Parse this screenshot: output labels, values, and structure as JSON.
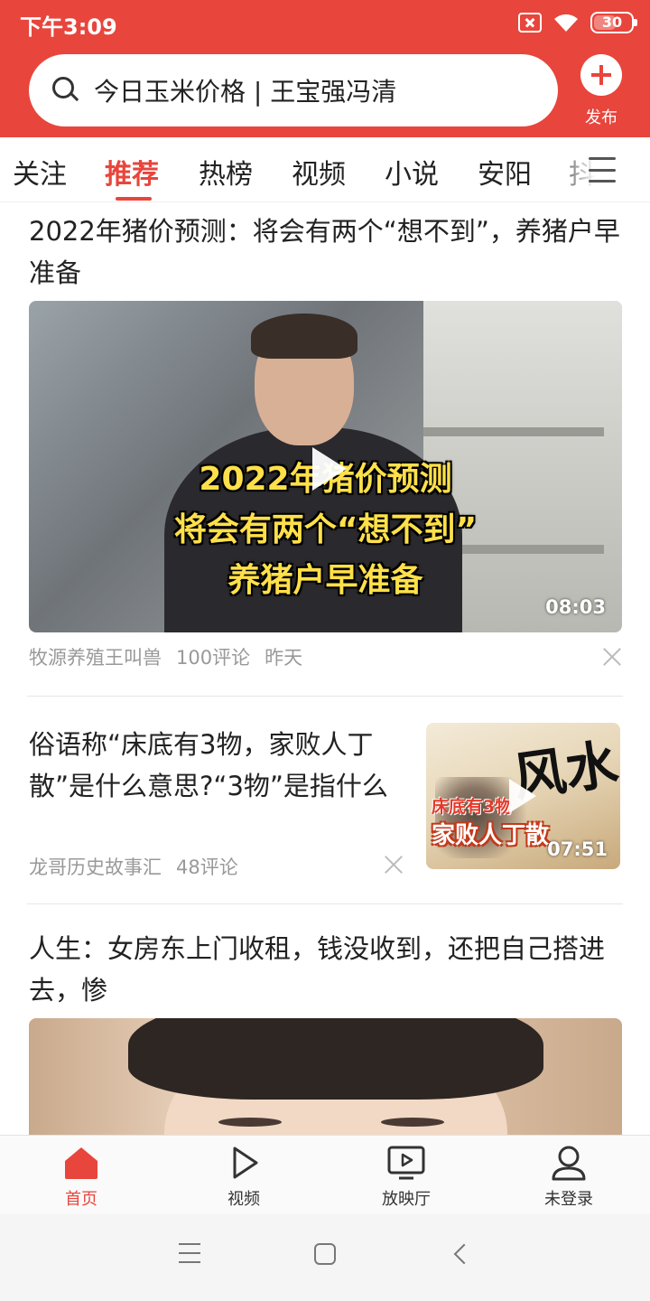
{
  "status_bar": {
    "time": "下午3:09",
    "battery": "30",
    "icons": [
      "sim-off-icon",
      "wifi-icon",
      "battery-icon"
    ]
  },
  "header": {
    "search_placeholder": "今日玉米价格 | 王宝强冯清",
    "publish_label": "发布",
    "accent_color": "#e8453c"
  },
  "tabs": {
    "items": [
      {
        "label": "关注"
      },
      {
        "label": "推荐",
        "active": true
      },
      {
        "label": "热榜"
      },
      {
        "label": "视频"
      },
      {
        "label": "小说"
      },
      {
        "label": "安阳"
      },
      {
        "label": "抖"
      }
    ]
  },
  "feed": {
    "articles": [
      {
        "title": "2022年猪价预测：将会有两个“想不到”，养猪户早准备",
        "video_overlay": [
          "2022年猪价预测",
          "将会有两个“想不到”",
          "养猪户早准备"
        ],
        "duration": "08:03",
        "source": "牧源养殖王叫兽",
        "comments": "100评论",
        "time": "昨天"
      },
      {
        "title": "俗语称“床底有3物，家败人丁散”是什么意思?“3物”是指什么",
        "video_overlay": [
          "床底有3物",
          "家败人丁散",
          "风水"
        ],
        "duration": "07:51",
        "source": "龙哥历史故事汇",
        "comments": "48评论"
      },
      {
        "title": "人生：女房东上门收租，钱没收到，还把自己搭进去，惨"
      }
    ]
  },
  "bottom_nav": {
    "items": [
      {
        "label": "首页",
        "icon": "home-icon",
        "active": true
      },
      {
        "label": "视频",
        "icon": "play-icon"
      },
      {
        "label": "放映厅",
        "icon": "tv-icon"
      },
      {
        "label": "未登录",
        "icon": "user-icon"
      }
    ]
  }
}
